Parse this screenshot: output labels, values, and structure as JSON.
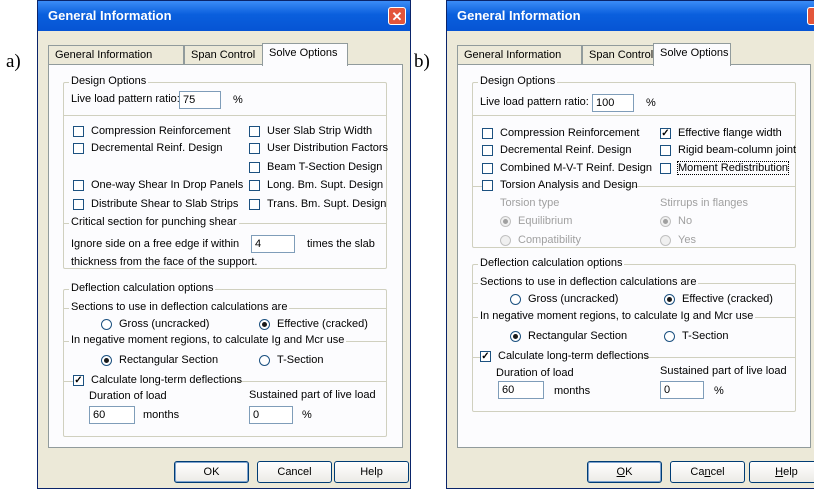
{
  "labels": {
    "a": "a)",
    "b": "b)"
  },
  "colors": {
    "titlebar": "#0a5fdd",
    "dialog_bg": "#ece9d8",
    "close": "#e3553a"
  },
  "dialog_a": {
    "title": "General Information",
    "close_glyph": "✕",
    "tabs": [
      "General Information",
      "Span Control",
      "Solve Options"
    ],
    "active_tab": "Solve Options",
    "design_options": {
      "label": "Design Options",
      "live_load_label": "Live load pattern ratio:",
      "live_load_value": "75",
      "live_load_unit": "%",
      "left_checks": [
        {
          "label": "Compression Reinforcement",
          "checked": false
        },
        {
          "label": "Decremental Reinf. Design",
          "checked": false
        },
        {
          "label": "One-way Shear In Drop Panels",
          "checked": false
        },
        {
          "label": "Distribute Shear to Slab Strips",
          "checked": false
        }
      ],
      "right_checks": [
        {
          "label": "User Slab Strip Width",
          "checked": false
        },
        {
          "label": "User Distribution Factors",
          "checked": false
        },
        {
          "label": "Beam T-Section Design",
          "checked": false
        },
        {
          "label": "Long. Bm. Supt. Design",
          "checked": false
        },
        {
          "label": "Trans. Bm. Supt. Design",
          "checked": false
        }
      ],
      "punching_label": "Critical section for punching shear",
      "punching_line1": "Ignore side on a free edge if within",
      "punching_value": "4",
      "punching_line1b": "times the slab",
      "punching_line2": "thickness from the face of the support."
    },
    "deflection": {
      "label": "Deflection calculation options",
      "sections_label": "Sections to use in deflection calculations are",
      "gross": "Gross (uncracked)",
      "effective": "Effective (cracked)",
      "negative_label": "In negative moment regions, to calculate Ig and Mcr use",
      "rect": "Rectangular Section",
      "tsec": "T-Section",
      "longterm": "Calculate long-term deflections",
      "duration_label": "Duration of load",
      "duration_value": "60",
      "months": "months",
      "sustained_label": "Sustained part of live load",
      "sustained_value": "0",
      "percent": "%"
    },
    "buttons": {
      "ok": "OK",
      "cancel": "Cancel",
      "help": "Help"
    }
  },
  "dialog_b": {
    "title": "General Information",
    "tabs": [
      "General Information",
      "Span Control",
      "Solve Options"
    ],
    "active_tab": "Solve Options",
    "design_options": {
      "label": "Design Options",
      "live_load_label": "Live load pattern ratio:",
      "live_load_value": "100",
      "live_load_unit": "%",
      "left_checks": [
        {
          "label": "Compression Reinforcement",
          "checked": false
        },
        {
          "label": "Decremental Reinf. Design",
          "checked": false
        },
        {
          "label": "Combined M-V-T Reinf. Design",
          "checked": false
        },
        {
          "label": "Torsion Analysis and Design",
          "checked": false
        }
      ],
      "right_checks": [
        {
          "label": "Effective flange width",
          "checked": true
        },
        {
          "label": "Rigid beam-column joint",
          "checked": false
        },
        {
          "label": "Moment Redistribution",
          "checked": false
        }
      ],
      "torsion_type_label": "Torsion type",
      "equilibrium": "Equilibrium",
      "compatibility": "Compatibility",
      "stirrups_label": "Stirrups in flanges",
      "no": "No",
      "yes": "Yes"
    },
    "deflection": {
      "label": "Deflection calculation options",
      "sections_label": "Sections to use in deflection calculations are",
      "gross": "Gross (uncracked)",
      "effective": "Effective (cracked)",
      "negative_label": "In negative moment regions, to calculate Ig and Mcr use",
      "rect": "Rectangular Section",
      "tsec": "T-Section",
      "longterm": "Calculate long-term deflections",
      "duration_label": "Duration of load",
      "duration_value": "60",
      "months": "months",
      "sustained_label": "Sustained part of live load",
      "sustained_value": "0",
      "percent": "%"
    },
    "buttons": {
      "ok_u": "O",
      "ok_rest": "K",
      "cancel_pre": "Ca",
      "cancel_u": "n",
      "cancel_post": "cel",
      "help_u": "H",
      "help_rest": "elp"
    }
  }
}
